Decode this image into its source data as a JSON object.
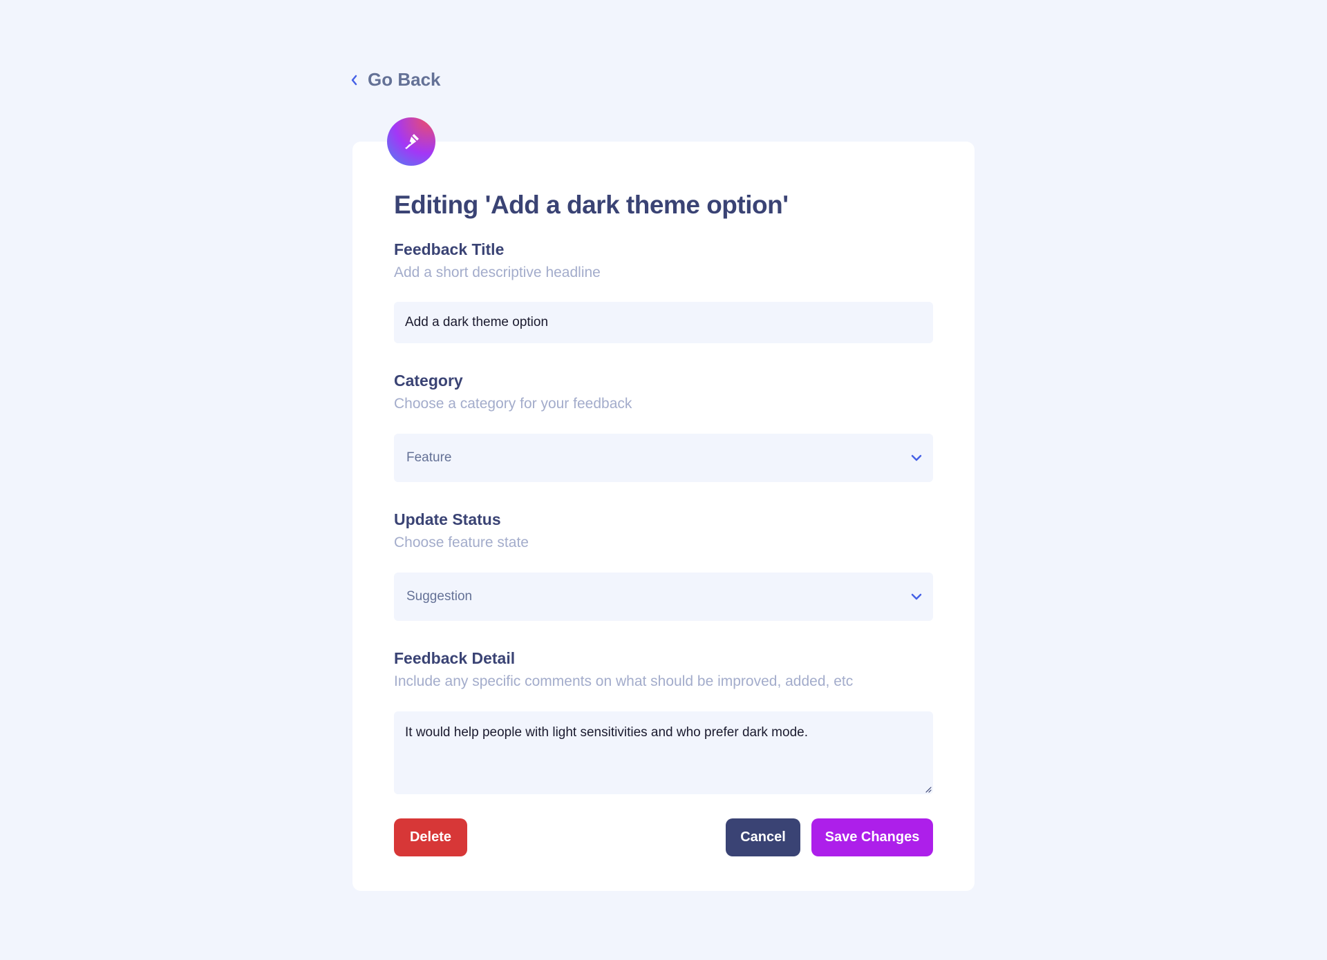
{
  "nav": {
    "back_label": "Go Back",
    "back_icon": "chevron-left-icon"
  },
  "badge": {
    "icon": "pen-icon"
  },
  "form": {
    "heading": "Editing 'Add a dark theme option'",
    "title_field": {
      "label": "Feedback Title",
      "help": "Add a short descriptive headline",
      "value": "Add a dark theme option"
    },
    "category_field": {
      "label": "Category",
      "help": "Choose a category for your feedback",
      "selected": "Feature"
    },
    "status_field": {
      "label": "Update Status",
      "help": "Choose feature state",
      "selected": "Suggestion"
    },
    "detail_field": {
      "label": "Feedback Detail",
      "help": "Include any specific comments on what should be improved, added, etc",
      "value": "It would help people with light sensitivities and who prefer dark mode."
    }
  },
  "actions": {
    "delete_label": "Delete",
    "cancel_label": "Cancel",
    "save_label": "Save Changes"
  },
  "colors": {
    "background": "#F2F5FD",
    "heading": "#3A4374",
    "muted": "#647196",
    "help": "#A3ACCB",
    "delete": "#D73737",
    "cancel": "#3A4374",
    "save": "#AD1FEA",
    "caret": "#4661E6"
  }
}
